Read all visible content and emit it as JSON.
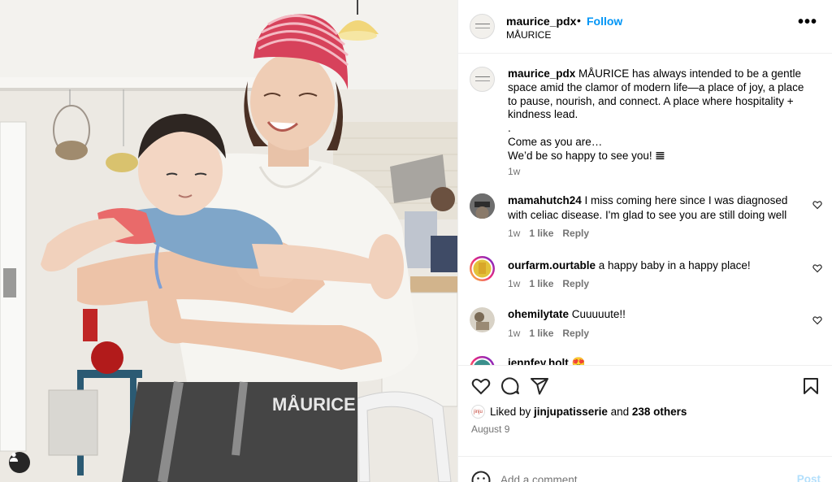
{
  "post": {
    "username": "maurice_pdx",
    "follow_label": "Follow",
    "dot": "•",
    "location": "MÅURICE",
    "more_label": "•••",
    "caption": {
      "username": "maurice_pdx",
      "text": " MÅURICE has always intended to be a gentle space amid the clamor of modern life—a place of joy, a place to pause, nourish, and connect. A place where hospitality + kindness lead.\n.\nCome as you are…\nWe’d be so happy to see you! 𝌆",
      "time": "1w"
    },
    "comments": [
      {
        "username": "mamahutch24",
        "text": " I miss coming here since I was diagnosed with celiac disease. I'm glad to see you are still doing well",
        "time": "1w",
        "likes": "1 like",
        "reply": "Reply"
      },
      {
        "username": "ourfarm.ourtable",
        "text": " a happy baby in a happy place!",
        "time": "1w",
        "likes": "1 like",
        "reply": "Reply"
      },
      {
        "username": "ohemilytate",
        "text": " Cuuuuute!!",
        "time": "1w",
        "likes": "1 like",
        "reply": "Reply"
      },
      {
        "username": "jennfey.holt",
        "text": " 😍",
        "time": "",
        "likes": "",
        "reply": ""
      }
    ],
    "liked_by": {
      "prefix": "Liked by ",
      "user": "jinjupatisserie",
      "mid": " and ",
      "others": "238 others",
      "avatar_text": "jinju"
    },
    "date": "August 9",
    "add_comment_placeholder": "Add a comment...",
    "post_label": "Post",
    "apron_text": "MÅURICE"
  },
  "colors": {
    "link": "#0095f6",
    "post_disabled": "#b2dffc",
    "meta": "#737373"
  },
  "icons": {
    "heart": "heart-icon",
    "comment": "comment-icon",
    "share": "share-icon",
    "save": "bookmark-icon",
    "emoji": "emoji-icon",
    "tag": "user-tag-icon",
    "more": "more-options-icon"
  }
}
